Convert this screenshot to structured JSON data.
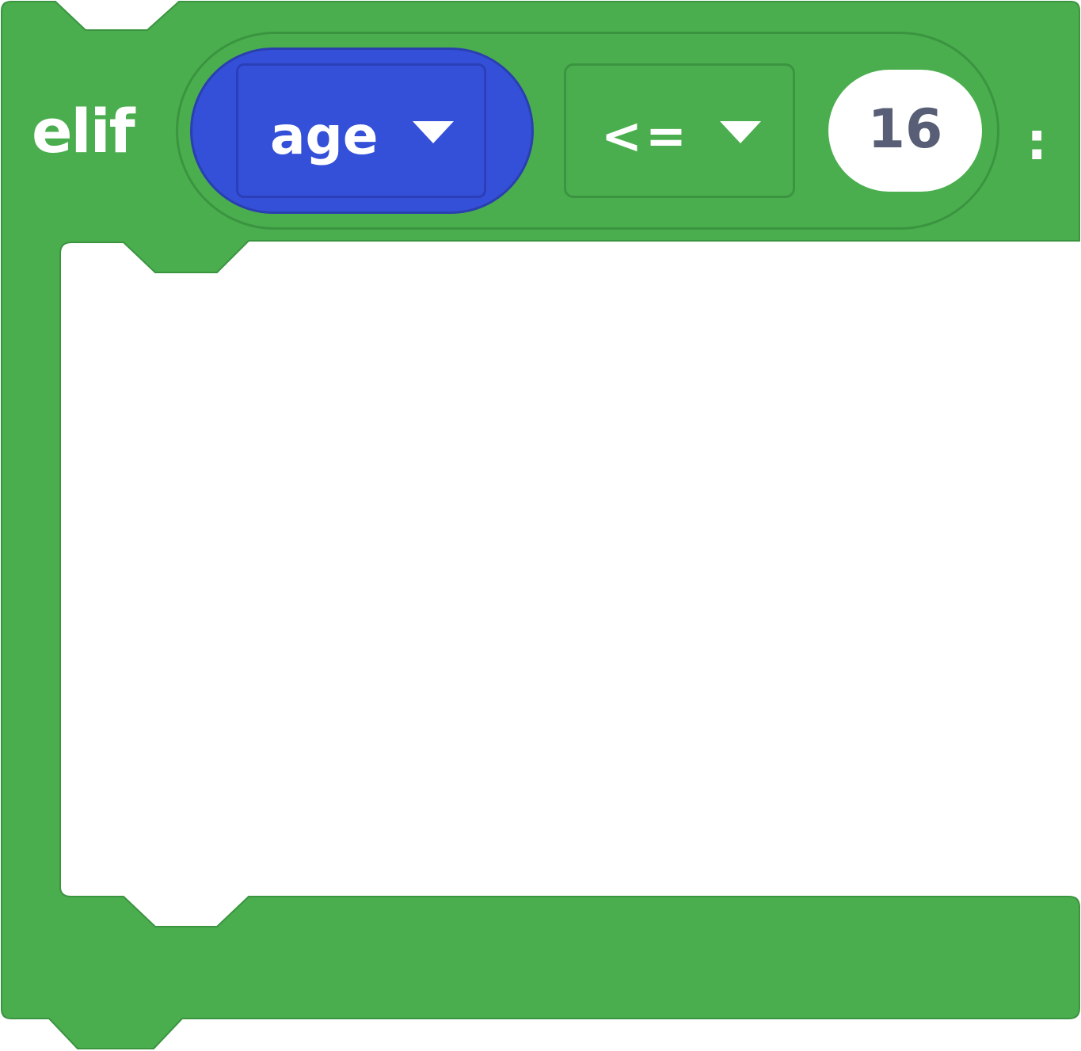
{
  "block": {
    "keyword": "elif",
    "colon": ":",
    "category_color": "#4aae4e",
    "variable": {
      "name": "age",
      "color": "#3550d8",
      "icon": "dropdown-caret-icon"
    },
    "operator": {
      "value": "<=",
      "icon": "dropdown-caret-icon"
    },
    "value": {
      "number": "16"
    }
  }
}
